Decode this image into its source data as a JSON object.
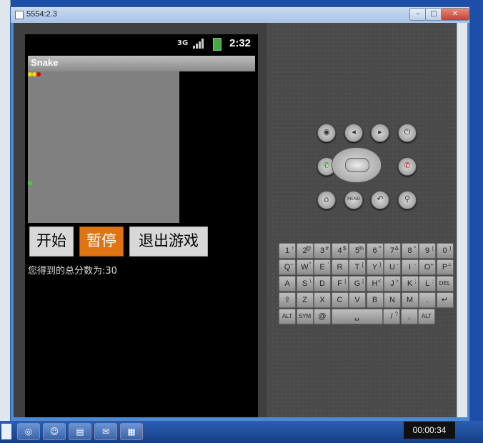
{
  "window": {
    "title": "5554:2.3",
    "min": "–",
    "max": "□",
    "close": "✕"
  },
  "status": {
    "network": "3G",
    "time": "2:32"
  },
  "app": {
    "title": "Snake",
    "buttons": {
      "start": "开始",
      "pause": "暂停",
      "quit": "退出游戏"
    },
    "score": "您得到的总分数为:30"
  },
  "emulator": {
    "controls": {
      "camera": "◉",
      "vol_down": "◂",
      "vol_up": "▸",
      "power": "⏻",
      "call": "✆",
      "end": "✆",
      "home": "⌂",
      "menu": "MENU",
      "back": "↶",
      "search": "⚲"
    },
    "keyboard": {
      "row1": [
        [
          "1",
          "!"
        ],
        [
          "2",
          "@"
        ],
        [
          "3",
          "#"
        ],
        [
          "4",
          "$"
        ],
        [
          "5",
          "%"
        ],
        [
          "6",
          "^"
        ],
        [
          "7",
          "&"
        ],
        [
          "8",
          "*"
        ],
        [
          "9",
          "("
        ],
        [
          "0",
          ")"
        ]
      ],
      "row2": [
        [
          "Q",
          "~"
        ],
        [
          "W",
          "\""
        ],
        [
          "E",
          "'"
        ],
        [
          "R",
          ""
        ],
        [
          "T",
          "{"
        ],
        [
          "Y",
          "}"
        ],
        [
          "U",
          "-"
        ],
        [
          "I",
          "-"
        ],
        [
          "O",
          "+"
        ],
        [
          "P",
          "="
        ]
      ],
      "row3": [
        [
          "A",
          ""
        ],
        [
          "S",
          "\\"
        ],
        [
          "D",
          ""
        ],
        [
          "F",
          "["
        ],
        [
          "G",
          "]"
        ],
        [
          "H",
          "<"
        ],
        [
          "J",
          ">"
        ],
        [
          "K",
          ";"
        ],
        [
          "L",
          ":"
        ],
        [
          "DEL",
          ""
        ]
      ],
      "row4": [
        [
          "⇧",
          ""
        ],
        [
          "Z",
          ""
        ],
        [
          "X",
          ""
        ],
        [
          "C",
          ""
        ],
        [
          "V",
          ""
        ],
        [
          "B",
          ""
        ],
        [
          "N",
          ""
        ],
        [
          "M",
          ""
        ],
        [
          ".",
          ""
        ],
        [
          "↵",
          ""
        ]
      ],
      "row5": [
        [
          "ALT",
          ""
        ],
        [
          "SYM",
          ""
        ],
        [
          "@",
          ""
        ],
        [
          "␣",
          ""
        ],
        [
          "/",
          "?"
        ],
        [
          ",",
          ""
        ],
        [
          "ALT",
          ""
        ]
      ]
    }
  },
  "taskbar": {
    "clock": "00:00:34"
  }
}
